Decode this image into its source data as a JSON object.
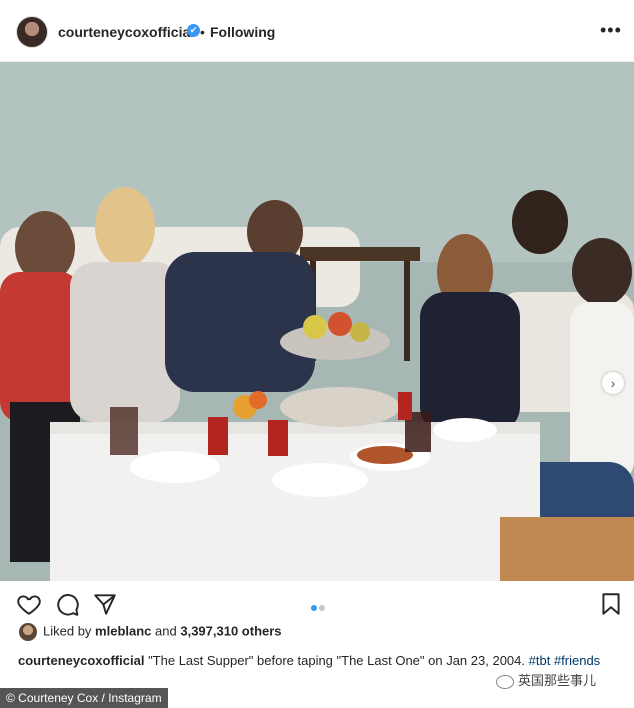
{
  "post": {
    "username": "courteneycoxofficial",
    "separator": "•",
    "follow_status": "Following",
    "more_label": "•••",
    "verified_mark": "✔"
  },
  "likes": {
    "prefix": "Liked by",
    "liker": "mleblanc",
    "and": "and",
    "count_text": "3,397,310 others"
  },
  "caption": {
    "username": "courteneycoxofficial",
    "text": "\"The Last Supper\" before taping \"The Last One\" on Jan 23, 2004.",
    "hashtags": [
      "#tbt",
      "#friends"
    ]
  },
  "carousel": {
    "current": 1,
    "total": 2
  },
  "overlay": {
    "credit": "© Courteney Cox / Instagram",
    "watermark": "英国那些事儿"
  },
  "icons": {
    "like": "heart-icon",
    "comment": "comment-icon",
    "share": "paper-plane-icon",
    "save": "bookmark-icon",
    "next": "chevron-right-icon"
  },
  "colors": {
    "verified": "#3897f0",
    "hashtag": "#00376b",
    "dot_active": "#3897f0"
  }
}
